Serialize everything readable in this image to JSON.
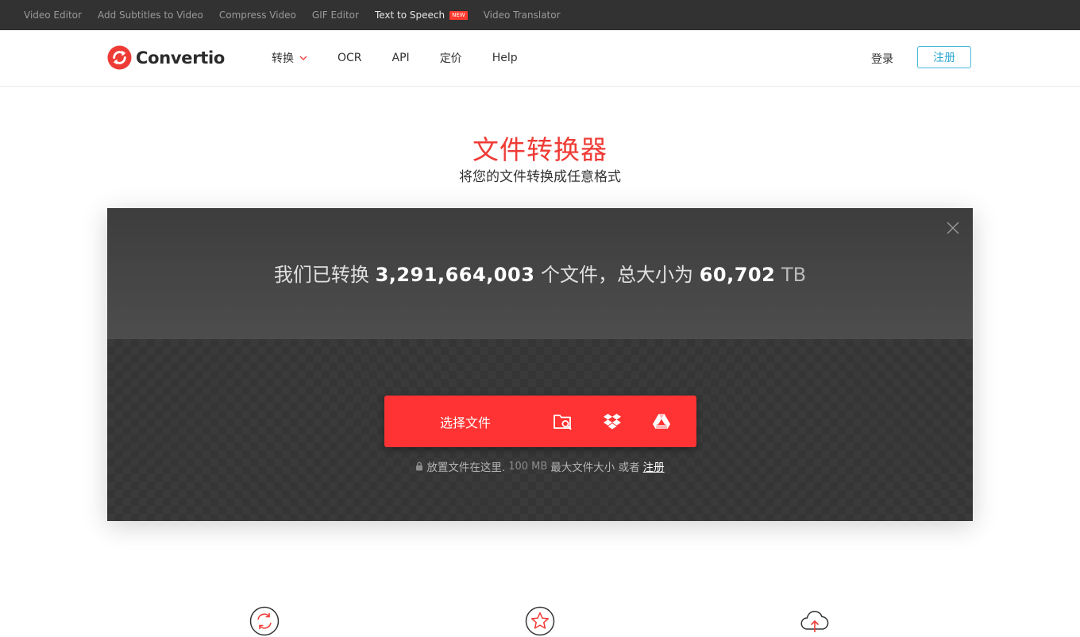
{
  "topbar": {
    "links": [
      {
        "label": "Video Editor"
      },
      {
        "label": "Add Subtitles to Video"
      },
      {
        "label": "Compress Video"
      },
      {
        "label": "GIF Editor"
      },
      {
        "label": "Text to Speech",
        "badge": "NEW"
      },
      {
        "label": "Video Translator"
      }
    ]
  },
  "header": {
    "logo_text": "Convertio",
    "nav": [
      {
        "label": "转换"
      },
      {
        "label": "OCR"
      },
      {
        "label": "API"
      },
      {
        "label": "定价"
      },
      {
        "label": "Help"
      }
    ],
    "login_label": "登录",
    "signup_label": "注册"
  },
  "hero": {
    "title": "文件转换器",
    "subtitle": "将您的文件转换成任意格式"
  },
  "stats": {
    "prefix": "我们已转换",
    "files_count": "3,291,664,003",
    "middle": "个文件，总大小为",
    "total_size": "60,702",
    "unit": "TB"
  },
  "uploader": {
    "choose_label": "选择文件",
    "icons": [
      "folder-search-icon",
      "dropbox-icon",
      "google-drive-icon"
    ],
    "hint_text": "放置文件在这里.",
    "max_size": "100 MB",
    "max_label": "最大文件大小 或者",
    "signup_link": "注册"
  },
  "features": [
    "refresh-icon",
    "star-icon",
    "cloud-upload-icon"
  ],
  "colors": {
    "brand_red": "#ff3333",
    "title_red": "#ef3b36",
    "signup_blue": "#2aa7d1",
    "topbar_bg": "#323232"
  }
}
